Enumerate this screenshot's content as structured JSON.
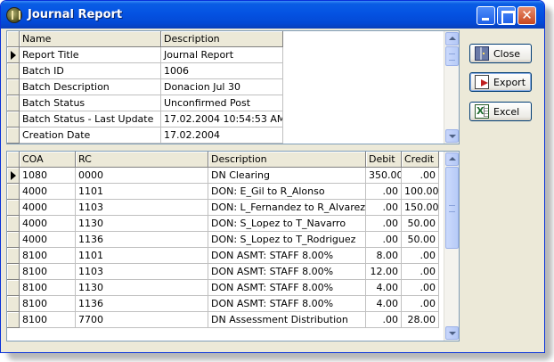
{
  "window": {
    "title": "Journal Report"
  },
  "header_grid": {
    "columns": [
      "Name",
      "Description"
    ],
    "rows": [
      {
        "name": "Report Title",
        "value": "Journal Report"
      },
      {
        "name": "Batch ID",
        "value": "1006"
      },
      {
        "name": "Batch Description",
        "value": "Donacion Jul 30"
      },
      {
        "name": "Batch Status",
        "value": "Unconfirmed Post"
      },
      {
        "name": "Batch Status - Last Update",
        "value": "17.02.2004 10:54:53 AM"
      },
      {
        "name": "Creation Date",
        "value": "17.02.2004"
      }
    ]
  },
  "detail_grid": {
    "columns": [
      "COA",
      "RC",
      "Description",
      "Debit",
      "Credit"
    ],
    "rows": [
      {
        "coa": "1080",
        "rc": "0000",
        "description": "DN Clearing",
        "debit": "350.00",
        "credit": ".00"
      },
      {
        "coa": "4000",
        "rc": "1101",
        "description": "DON: E_Gil to R_Alonso",
        "debit": ".00",
        "credit": "100.00"
      },
      {
        "coa": "4000",
        "rc": "1103",
        "description": "DON: L_Fernandez to R_Alvarez",
        "debit": ".00",
        "credit": "150.00"
      },
      {
        "coa": "4000",
        "rc": "1130",
        "description": "DON: S_Lopez to T_Navarro",
        "debit": ".00",
        "credit": "50.00"
      },
      {
        "coa": "4000",
        "rc": "1136",
        "description": "DON: S_Lopez to T_Rodriguez",
        "debit": ".00",
        "credit": "50.00"
      },
      {
        "coa": "8100",
        "rc": "1101",
        "description": "DON ASMT: STAFF 8.00%",
        "debit": "8.00",
        "credit": ".00"
      },
      {
        "coa": "8100",
        "rc": "1103",
        "description": "DON ASMT: STAFF 8.00%",
        "debit": "12.00",
        "credit": ".00"
      },
      {
        "coa": "8100",
        "rc": "1130",
        "description": "DON ASMT: STAFF 8.00%",
        "debit": "4.00",
        "credit": ".00"
      },
      {
        "coa": "8100",
        "rc": "1136",
        "description": "DON ASMT: STAFF 8.00%",
        "debit": "4.00",
        "credit": ".00"
      },
      {
        "coa": "8100",
        "rc": "7700",
        "description": "DN Assessment Distribution",
        "debit": ".00",
        "credit": "28.00"
      }
    ]
  },
  "buttons": {
    "close": {
      "label": "Close",
      "icon": "door-icon"
    },
    "export": {
      "label": "Export",
      "icon": "export-icon"
    },
    "excel": {
      "label": "Excel",
      "icon": "excel-icon"
    }
  },
  "colors": {
    "titlebar": "#0554e3",
    "window_face": "#ece9d8",
    "grid_border": "#7f9db9"
  }
}
